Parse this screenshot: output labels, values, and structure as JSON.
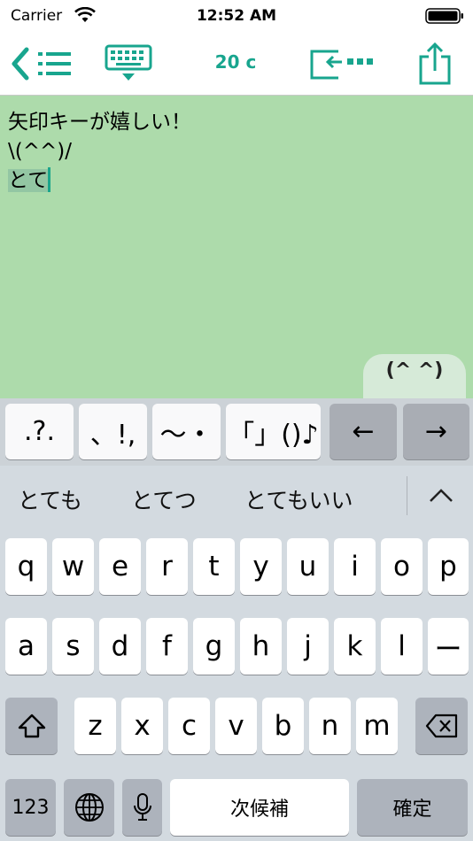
{
  "status_bar": {
    "carrier": "Carrier",
    "time": "12:52 AM"
  },
  "nav_bar": {
    "char_count": "20 c"
  },
  "editor": {
    "line1": "矢印キーが嬉しい！",
    "line2": "\\(^^)/",
    "marked_text": "とて"
  },
  "kaomoji_tab": {
    "label": "(^ ^)"
  },
  "accessory_keys": [
    ".?.",
    "、!,",
    "〜・",
    "「」()♪",
    "←",
    "→"
  ],
  "candidates": [
    "とても",
    "とてつ",
    "とてもいい"
  ],
  "keyboard": {
    "row1": [
      "q",
      "w",
      "e",
      "r",
      "t",
      "y",
      "u",
      "i",
      "o",
      "p"
    ],
    "row2": [
      "a",
      "s",
      "d",
      "f",
      "g",
      "h",
      "j",
      "k",
      "l",
      "ー"
    ],
    "row3": [
      "z",
      "x",
      "c",
      "v",
      "b",
      "n",
      "m"
    ],
    "numbers_label": "123",
    "space_label": "次候補",
    "confirm_label": "確定"
  },
  "colors": {
    "accent": "#18a58e",
    "editor_bg": "#addbab",
    "keyboard_bg": "#d3dae0"
  }
}
